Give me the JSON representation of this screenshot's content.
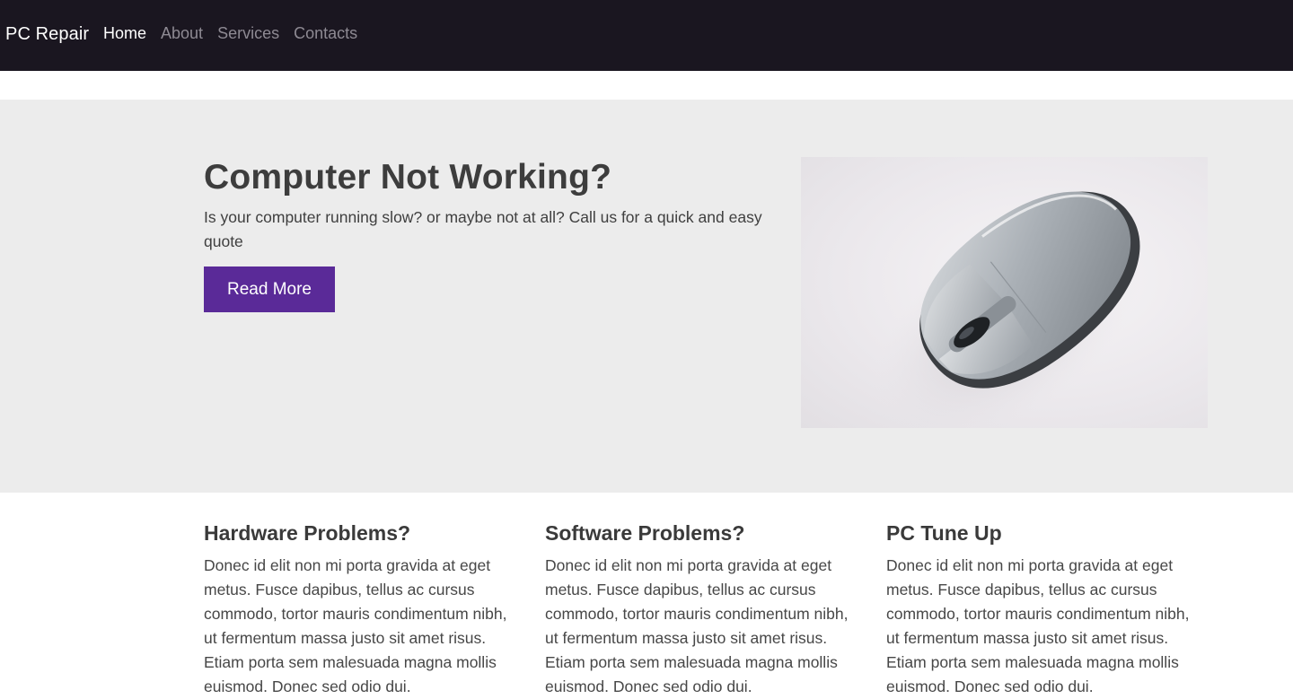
{
  "nav": {
    "brand": "PC Repair",
    "links": [
      "Home",
      "About",
      "Services",
      "Contacts"
    ],
    "active_index": 0
  },
  "hero": {
    "title": "Computer Not Working?",
    "text": "Is your computer running slow? or maybe not at all? Call us for a quick and easy quote",
    "button_label": "Read More",
    "button_color": "#5a2a98"
  },
  "features": [
    {
      "title": "Hardware Problems?",
      "text": "Donec id elit non mi porta gravida at eget metus. Fusce dapibus, tellus ac cursus commodo, tortor mauris condimentum nibh, ut fermentum massa justo sit amet risus. Etiam porta sem malesuada magna mollis euismod. Donec sed odio dui."
    },
    {
      "title": "Software Problems?",
      "text": "Donec id elit non mi porta gravida at eget metus. Fusce dapibus, tellus ac cursus commodo, tortor mauris condimentum nibh, ut fermentum massa justo sit amet risus. Etiam porta sem malesuada magna mollis euismod. Donec sed odio dui."
    },
    {
      "title": "PC Tune Up",
      "text": "Donec id elit non mi porta gravida at eget metus. Fusce dapibus, tellus ac cursus commodo, tortor mauris condimentum nibh, ut fermentum massa justo sit amet risus. Etiam porta sem malesuada magna mollis euismod. Donec sed odio dui."
    }
  ],
  "colors": {
    "navbar_bg": "#1a1620",
    "hero_bg": "#ececec",
    "accent": "#5a2a98"
  }
}
